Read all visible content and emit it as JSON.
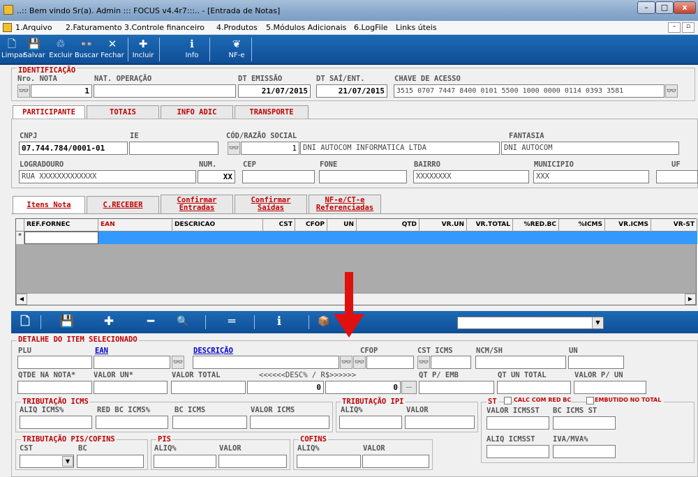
{
  "window": {
    "title": "..:: Bem vindo Sr(a). Admin ::: FOCUS v4.4r7:::..  - [Entrada de Notas]",
    "minimize": "–",
    "maximize": "□",
    "close": "x",
    "inner_min": "–",
    "inner_max": "▫"
  },
  "menu": [
    "1.Arquivo",
    "2.Faturamento",
    "3.Controle financeiro",
    "4.Produtos",
    "5.Módulos Adicionais",
    "6.LogFile",
    "Links úteis"
  ],
  "toolbar": {
    "limpar": "Limpar",
    "salvar": "Salvar",
    "excluir": "Excluir",
    "buscar": "Buscar",
    "fechar": "Fechar",
    "incluir": "Incluir",
    "info": "Info",
    "nfe": "NF-e"
  },
  "ident": {
    "section": "IDENTIFICAÇÃO",
    "nro_label": "Nro. NOTA",
    "nro_value": "1",
    "natop_label": "NAT. OPERAÇÃO",
    "natop_value": "",
    "dtem_label": "DT EMISSÃO",
    "dtem_value": "21/07/2015",
    "dtsai_label": "DT SAÍ/ENT.",
    "dtsai_value": "21/07/2015",
    "chave_label": "CHAVE DE ACESSO",
    "chave_value": "3515 0707 7447 8400 0101 5500 1000 0000 0114 0393 3581"
  },
  "tabs1": [
    "PARTICIPANTE",
    "TOTAIS",
    "INFO ADIC",
    "TRANSPORTE"
  ],
  "part": {
    "cnpj_label": "CNPJ",
    "cnpj_value": "07.744.784/0001-01",
    "ie_label": "IE",
    "ie_value": "",
    "cod_label": "CÓD/RAZÃO SOCIAL",
    "cod_value": "1",
    "razao_value": "DNI AUTOCOM INFORMATICA LTDA",
    "fantasia_label": "FANTASIA",
    "fantasia_value": "DNI AUTOCOM",
    "log_label": "LOGRADOURO",
    "log_value": "RUA XXXXXXXXXXXXX",
    "num_label": "NUM.",
    "num_value": "XX",
    "cep_label": "CEP",
    "cep_value": "",
    "fone_label": "FONE",
    "fone_value": "",
    "bairro_label": "BAIRRO",
    "bairro_value": "XXXXXXXX",
    "mun_label": "MUNICIPIO",
    "mun_value": "XXX",
    "uf_label": "UF",
    "uf_value": ""
  },
  "tabs2": [
    {
      "l1": "Itens Nota",
      "l2": ""
    },
    {
      "l1": "C.RECEBER",
      "l2": ""
    },
    {
      "l1": "Confirmar",
      "l2": "Entradas"
    },
    {
      "l1": "Confirmar",
      "l2": "Saídas"
    },
    {
      "l1": "NF-e/CT-e",
      "l2": "Referenciadas"
    }
  ],
  "grid": {
    "columns": [
      "REF.FORNEC",
      "EAN",
      "DESCRICAO",
      "CST",
      "CFOP",
      "UN",
      "QTD",
      "VR.UN",
      "VR.TOTAL",
      "%RED.BC",
      "%ICMS",
      "VR.ICMS",
      "VR-ST"
    ],
    "row_marker": "*",
    "scroll_left": "◀",
    "scroll_right": "▶"
  },
  "bottom_toolbar": {
    "new": "🗋",
    "save": "💾",
    "add": "✚",
    "remove": "━",
    "search": "🔍",
    "equals": "═",
    "info": "ℹ",
    "box": "📦",
    "dropdown_value": "",
    "dropdown_arrow": "▼"
  },
  "detail": {
    "section": "DETALHE DO ITEM SELECIONADO",
    "plu": "PLU",
    "ean": "EAN",
    "descricao": "DESCRIÇÃO",
    "cfop": "CFOP",
    "cst_icms": "CST ICMS",
    "ncm": "NCM/SH",
    "un": "UN",
    "qtde": "QTDE NA NOTA*",
    "valor_un": "VALOR UN*",
    "valor_total": "VALOR TOTAL",
    "desc": "<<<<<<DESC% / R$>>>>>>",
    "desc_pct": "0",
    "desc_rs": "0",
    "dots": "...",
    "qt_emb": "QT P/ EMB",
    "qt_un_total": "QT UN TOTAL",
    "valor_p_un": "VALOR P/ UN"
  },
  "icms": {
    "section": "TRIBUTAÇÃO ICMS",
    "aliq": "ALIQ ICMS%",
    "red": "RED BC ICMS%",
    "bc": "BC ICMS",
    "valor": "VALOR ICMS"
  },
  "ipi": {
    "section": "TRIBUTAÇÃO IPI",
    "aliq": "ALIQ%",
    "valor": "VALOR"
  },
  "st": {
    "section": "ST",
    "calc": "CALC COM RED BC",
    "embutido": "EMBUTIDO NO TOTAL",
    "valor_icmsst": "VALOR ICMSST",
    "bc_icms_st": "BC ICMS ST",
    "aliq_icmsst": "ALIQ ICMSST",
    "iva": "IVA/MVA%"
  },
  "pis_cofins": {
    "section": "TRIBUTAÇÃO PIS/COFINS",
    "cst": "CST",
    "bc": "BC"
  },
  "pis": {
    "section": "PIS",
    "aliq": "ALIQ%",
    "valor": "VALOR"
  },
  "cofins": {
    "section": "COFINS",
    "aliq": "ALIQ%",
    "valor": "VALOR"
  },
  "colors": {
    "toolbar": "#1560ad",
    "red": "#c00000",
    "selection": "#3399ff",
    "arrow": "#e01010"
  }
}
